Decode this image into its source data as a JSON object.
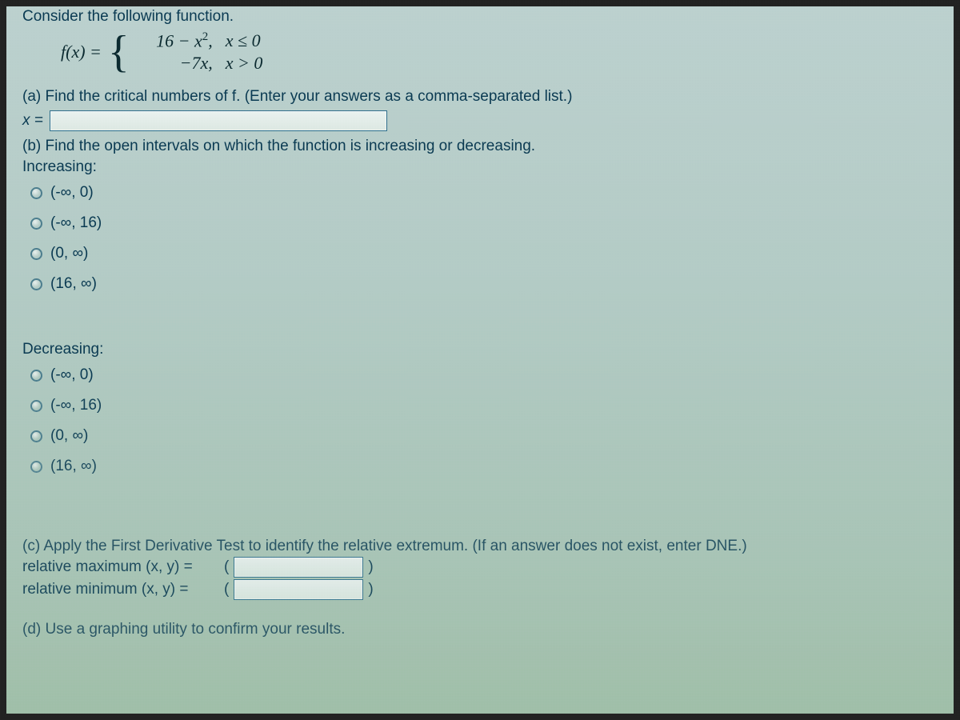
{
  "intro": "Consider the following function.",
  "formula": {
    "lhs": "f(x) =",
    "piece1_expr": "16 − x",
    "piece1_sup": "2",
    "piece1_comma": ",",
    "piece1_cond": "x ≤ 0",
    "piece2_expr": "−7x,",
    "piece2_cond": "x > 0"
  },
  "part_a": {
    "prompt": "(a) Find the critical numbers of f. (Enter your answers as a comma-separated list.)",
    "x_label": "x =",
    "answer_value": ""
  },
  "part_b": {
    "prompt": "(b) Find the open intervals on which the function is increasing or decreasing.",
    "increasing_label": "Increasing:",
    "decreasing_label": "Decreasing:",
    "options": [
      "(-∞, 0)",
      "(-∞, 16)",
      "(0, ∞)",
      "(16, ∞)"
    ]
  },
  "part_c": {
    "prompt": "(c) Apply the First Derivative Test to identify the relative extremum. (If an answer does not exist, enter DNE.)",
    "max_label": "relative maximum (x, y) =",
    "min_label": "relative minimum (x, y) =",
    "open_paren": "(",
    "close_paren": ")",
    "max_value": "",
    "min_value": ""
  },
  "part_d": {
    "prompt": "(d) Use a graphing utility to confirm your results."
  }
}
